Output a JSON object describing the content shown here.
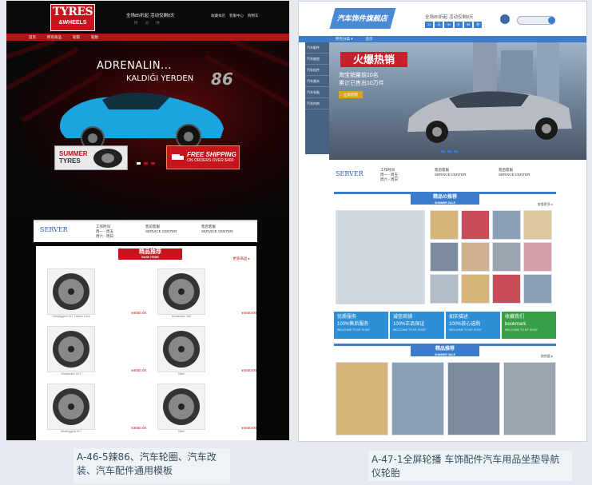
{
  "left_panel": {
    "logo_line1": "TYRES",
    "logo_line2": "&WHEELS",
    "promo_text": "全场85折起·活动仅剩8天",
    "promo_sub": "时 分 秒",
    "top_links": [
      "收藏本店",
      "客服中心",
      "购物车"
    ],
    "nav": [
      "首页",
      "所有商品",
      "轮毂",
      "轮胎"
    ],
    "hero_title": "ADRENALIN...",
    "hero_subtitle": "KALDIĞI YERDEN",
    "hero_model": "86",
    "btn_summer_1": "SUMMER",
    "btn_summer_2": "TYRES",
    "btn_free_1": "FREE SHIPPING",
    "btn_free_2": "ON ORDERS OVER $400",
    "service_logo": "SERVER",
    "service_cols": [
      {
        "title": "工作时间",
        "lines": [
          "周一 - 周五",
          "周六 - 周日"
        ]
      },
      {
        "title": "售前客服",
        "lines": [
          "SERVICE CENTER"
        ]
      },
      {
        "title": "售后客服",
        "lines": [
          "SERVICE CENTER"
        ]
      }
    ],
    "section_title": "精品推荐",
    "section_sub": "BASE ITEMS",
    "section_more": "更多商品 ▸",
    "wheels": [
      {
        "name": "Ultraleggera HLT Carbon Lock",
        "price": "¥4650.00"
      },
      {
        "name": "Montecarlo 16Z",
        "price": "¥4650.00"
      },
      {
        "name": "Montecarlo HLT",
        "price": "¥4650.00"
      },
      {
        "name": "Silver",
        "price": "¥4650.00"
      },
      {
        "name": "Ultraleggera HLT",
        "price": "¥3650.00"
      },
      {
        "name": "Silver",
        "price": "¥4650.00"
      }
    ]
  },
  "right_panel": {
    "logo": "汽车饰件旗舰店",
    "promo_text": "全场85折起·活动仅剩8天",
    "tags": [
      "12",
      "天",
      "30",
      "分",
      "56",
      "秒"
    ],
    "nav": [
      "所有分类 ▾",
      "首页"
    ],
    "side_items": [
      "汽车配件",
      "汽车座垫",
      "汽车挂件",
      "汽车香水",
      "汽车车贴",
      "汽车内饰"
    ],
    "hero_title": "火爆热销",
    "hero_line1": "淘宝销量前10名",
    "hero_line2": "累计已售出10万件",
    "hero_btn": "立即抢购",
    "service_logo": "SERVER",
    "service_cols": [
      {
        "title": "工作时间",
        "lines": [
          "周一 - 周五",
          "周六 - 周日"
        ]
      },
      {
        "title": "售前客服",
        "lines": [
          "SERVICE CENTER"
        ]
      },
      {
        "title": "售后客服",
        "lines": [
          "SERVICE CENTER"
        ]
      }
    ],
    "sec1_title": "精品の推荐",
    "sec1_sub": "SUMMER SALE",
    "sec1_more": "查看更多 ▸",
    "feats": [
      {
        "t1": "优质服务",
        "t2": "100%售后服务",
        "s": "WELCOME TO MY SHOP",
        "color": "#2f8fd6"
      },
      {
        "t1": "诚信商铺",
        "t2": "100%正品保证",
        "s": "WELCOME TO MY SHOP",
        "color": "#2f8fd6"
      },
      {
        "t1": "如实描述",
        "t2": "100%放心选购",
        "s": "WELCOME TO MY SHOP",
        "color": "#2f8fd6"
      },
      {
        "t1": "收藏我们",
        "t2": "bookmark",
        "s": "WELCOME TO MY SHOP",
        "color": "#3aa047"
      }
    ],
    "sec2_title": "精品推荐",
    "sec2_sub": "SUMMER SALE",
    "sec2_more": "按销量 ▸"
  },
  "captions": {
    "left": "A-46-5辣86、汽车轮圈、汽车改装、汽车配件通用模板",
    "right": "A-47-1全屏轮播 车饰配件汽车用品坐垫导航仪轮胎"
  }
}
